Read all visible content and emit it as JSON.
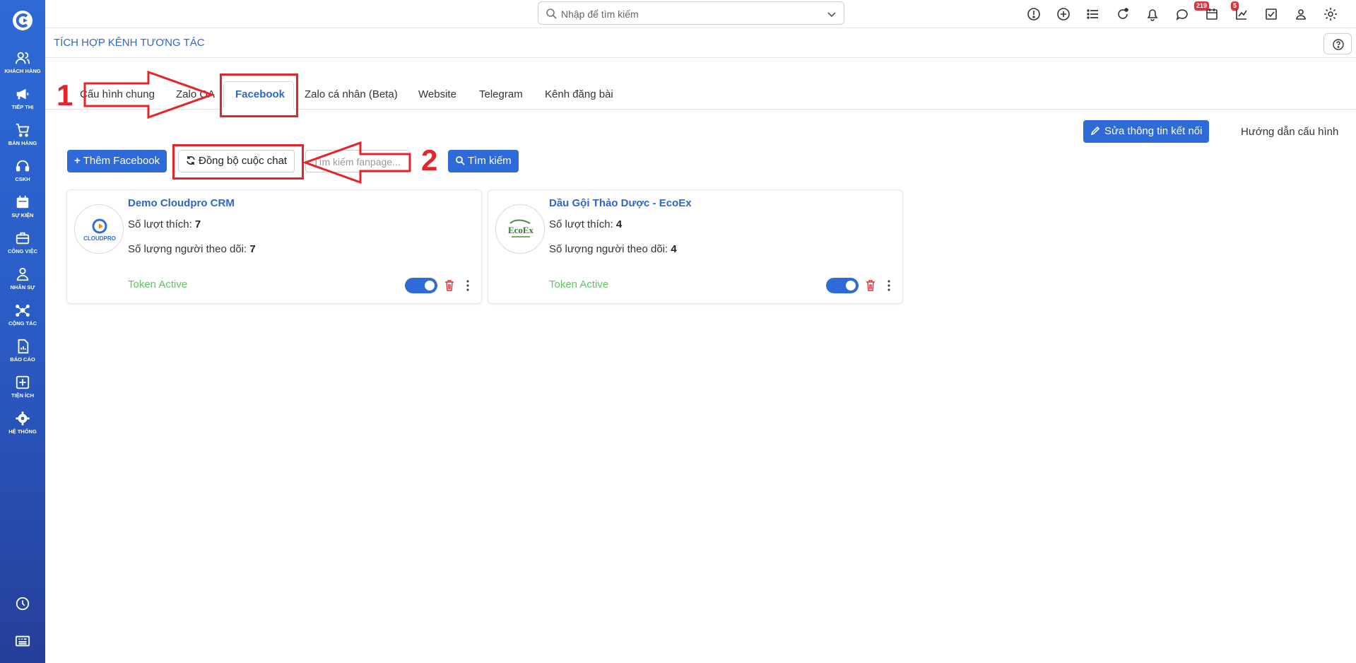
{
  "colors": {
    "brand": "#2f6bd8",
    "sidebar_top": "#2d6ad6",
    "sidebar_bottom": "#253f99",
    "token_active": "#5cc75c",
    "annotation": "#e5242a",
    "badge": "#d9363e",
    "delete": "#d9363e"
  },
  "sidebar": {
    "items": [
      {
        "label": "KHÁCH HÀNG",
        "icon": "users-icon"
      },
      {
        "label": "TIẾP THỊ",
        "icon": "megaphone-icon"
      },
      {
        "label": "BÁN HÀNG",
        "icon": "cart-icon"
      },
      {
        "label": "CSKH",
        "icon": "headset-icon"
      },
      {
        "label": "SỰ KIỆN",
        "icon": "calendar-icon"
      },
      {
        "label": "CÔNG VIỆC",
        "icon": "briefcase-icon"
      },
      {
        "label": "NHÂN SỰ",
        "icon": "person-icon"
      },
      {
        "label": "CỘNG TÁC",
        "icon": "network-icon"
      },
      {
        "label": "BÁO CÁO",
        "icon": "report-icon"
      },
      {
        "label": "TIỆN ÍCH",
        "icon": "plus-square-icon"
      },
      {
        "label": "HỆ THỐNG",
        "icon": "gear-icon"
      }
    ],
    "bottom_icons": [
      "clock-icon",
      "keyboard-icon"
    ]
  },
  "topbar": {
    "search_placeholder": "Nhập để tìm kiếm",
    "icons": [
      "alert-icon",
      "add-icon",
      "list-icon",
      "refresh-icon",
      "bell-icon",
      "chat-icon",
      "calendar-icon",
      "chart-icon",
      "checkbox-icon",
      "user-icon",
      "settings-icon"
    ],
    "notifications_count": "219",
    "messages_count": "5"
  },
  "page": {
    "title": "TÍCH HỢP KÊNH TƯƠNG TÁC",
    "help_icon": "help-icon"
  },
  "tabs": [
    {
      "label": "Cấu hình chung"
    },
    {
      "label": "Zalo OA"
    },
    {
      "label": "Facebook",
      "active": true
    },
    {
      "label": "Zalo cá nhân (Beta)"
    },
    {
      "label": "Website"
    },
    {
      "label": "Telegram"
    },
    {
      "label": "Kênh đăng bài"
    }
  ],
  "actions": {
    "edit_connection": "Sửa thông tin kết nối",
    "guide": "Hướng dẫn cấu hình",
    "add_facebook": "Thêm Facebook",
    "sync_chat": "Đồng bộ cuộc chat",
    "search_placeholder": "Tìm kiếm fanpage...",
    "search_button": "Tìm kiếm"
  },
  "fanpages": [
    {
      "name": "Demo Cloudpro CRM",
      "likes_label": "Số lượt thích:",
      "likes": "7",
      "followers_label": "Số lượng người theo dõi:",
      "followers": "7",
      "token_status": "Token Active",
      "enabled": true,
      "logo_text": "CLOUDPRO"
    },
    {
      "name": "Dầu Gội Thảo Dược - EcoEx",
      "likes_label": "Số lượt thích:",
      "likes": "4",
      "followers_label": "Số lượng người theo dõi:",
      "followers": "4",
      "token_status": "Token Active",
      "enabled": true,
      "logo_text": "EcoEx"
    }
  ],
  "annotations": [
    {
      "number": "1"
    },
    {
      "number": "2"
    }
  ]
}
